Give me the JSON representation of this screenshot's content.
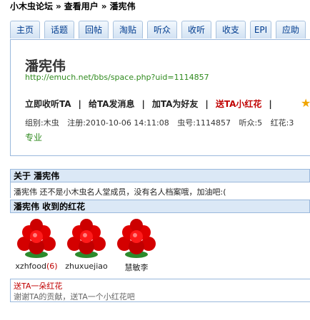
{
  "breadcrumb": {
    "forum": "小木虫论坛",
    "section": "查看用户",
    "user": "潘宪伟",
    "sep": "»"
  },
  "tabs": [
    "主页",
    "话题",
    "回帖",
    "淘贴",
    "听众",
    "收听",
    "收支",
    "EPI",
    "应助"
  ],
  "profile": {
    "name": "潘宪伟",
    "url": "http://emuch.net/bbs/space.php?uid=1114857",
    "actions": [
      "立即收听TA",
      "给TA发消息",
      "加TA为好友",
      "送TA小红花"
    ],
    "action_sep": "|",
    "group": "组别:木虫",
    "registered": "注册:2010-10-06 14:11:08",
    "uid": "虫号:1114857",
    "listeners": "听众:5",
    "flowers": "红花:3",
    "major": "专业"
  },
  "about": {
    "title": "关于 潘宪伟",
    "text": "潘宪伟 还不是小木虫名人堂成员，没有名人档案哦，加油吧:("
  },
  "received": {
    "title": "潘宪伟 收到的红花",
    "items": [
      {
        "name": "xzhfood",
        "count": "(6)"
      },
      {
        "name": "zhuxuejiao",
        "count": ""
      },
      {
        "name": "慧敏李",
        "count": ""
      }
    ]
  },
  "send": {
    "title": "送TA一朵红花",
    "desc": "谢谢TA的贡献，送TA一个小红花吧"
  },
  "colors": {
    "link_blue": "#003c8f",
    "url_green": "#2f8a1e",
    "accent_red": "#c00000",
    "header_bg": "#dbe8f6",
    "border": "#9ab8dc"
  }
}
